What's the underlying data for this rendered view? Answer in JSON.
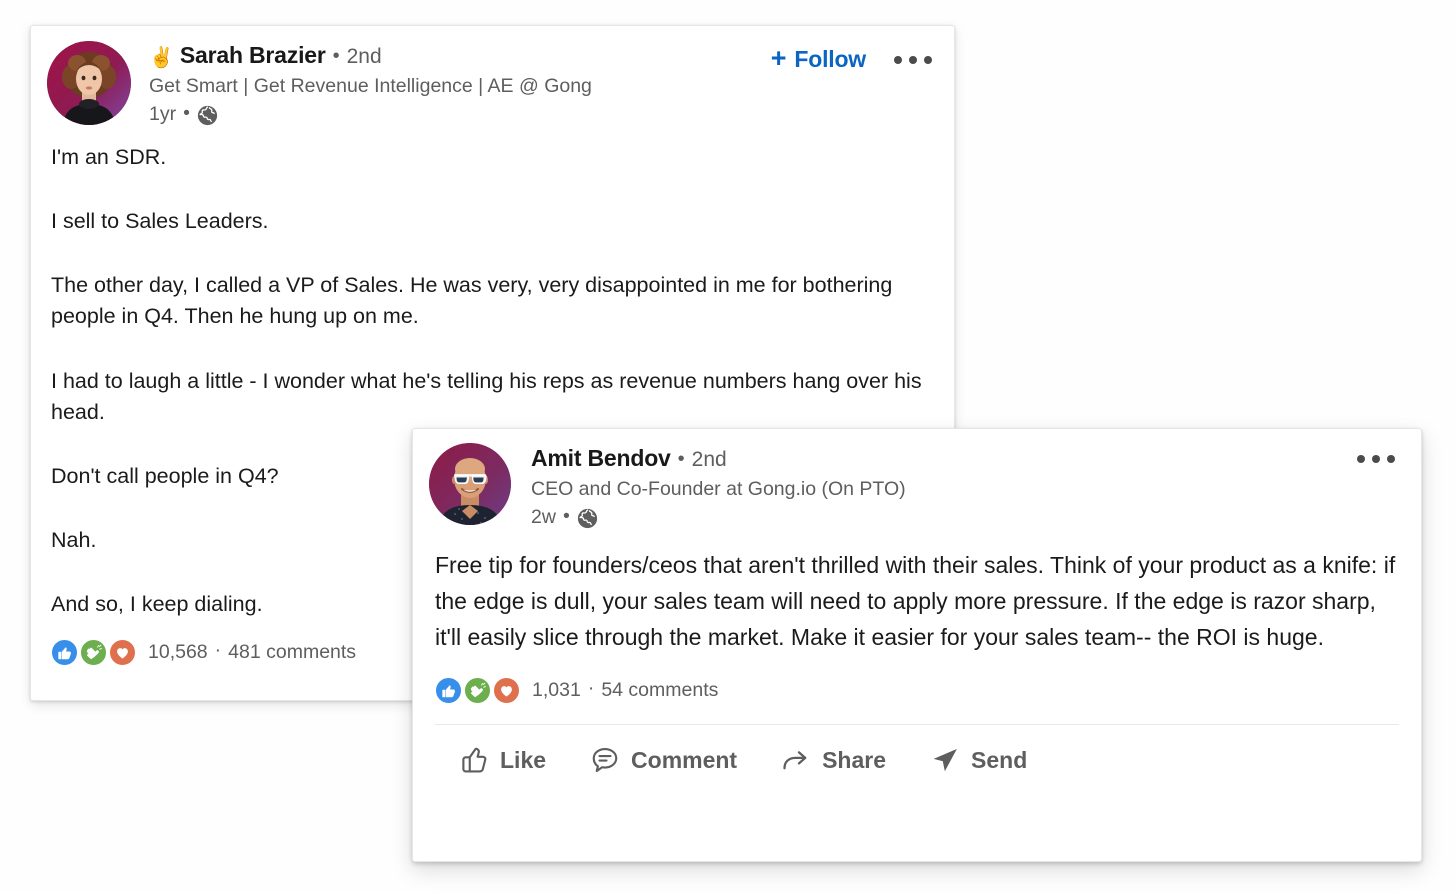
{
  "app": {
    "platform": "LinkedIn",
    "background_color": "#fefefe",
    "accent_color": "#0a66c2",
    "text_primary_color": "#1b1b1b",
    "text_secondary_color": "#5e5e5e"
  },
  "posts": [
    {
      "id": "post-sarah",
      "author": {
        "emoji": "✌️",
        "name": "Sarah Brazier",
        "degree_separator": "•",
        "degree": "2nd",
        "headline": "Get Smart | Get Revenue Intelligence | AE @ Gong",
        "avatar_alt": "Sarah Brazier profile photo"
      },
      "meta": {
        "timestamp": "1yr",
        "separator": "•",
        "visibility_icon": "globe-icon"
      },
      "header_actions": {
        "follow_plus": "+",
        "follow_label": "Follow",
        "more_label": "More options"
      },
      "body_paragraphs": [
        "I'm an SDR.",
        "I sell to Sales Leaders.",
        "The other day, I called a VP of Sales. He was very, very disappointed in me for bothering people in Q4. Then he hung up on me.",
        "I had to laugh a little - I wonder what he's telling his reps as revenue numbers hang over his head.",
        "Don't call people in Q4?",
        "Nah.",
        "And so, I keep dialing."
      ],
      "social": {
        "reactions": [
          "like",
          "celebrate",
          "love"
        ],
        "reaction_count": "10,568",
        "separator": "·",
        "comments": "481 comments"
      }
    },
    {
      "id": "post-amit",
      "author": {
        "emoji": "",
        "name": "Amit Bendov",
        "degree_separator": "•",
        "degree": "2nd",
        "headline": "CEO and Co-Founder at Gong.io (On PTO)",
        "avatar_alt": "Amit Bendov profile photo"
      },
      "meta": {
        "timestamp": "2w",
        "separator": "•",
        "visibility_icon": "globe-icon"
      },
      "header_actions": {
        "more_label": "More options"
      },
      "body_paragraphs": [
        "Free tip for founders/ceos that aren't thrilled with their sales. Think of your product as a knife: if the edge is dull, your sales team will need to apply more pressure. If the edge is razor sharp, it'll easily slice through the market. Make it easier for your sales team-- the ROI is huge."
      ],
      "social": {
        "reactions": [
          "like",
          "celebrate",
          "love"
        ],
        "reaction_count": "1,031",
        "separator": "·",
        "comments": "54 comments"
      },
      "actions": [
        {
          "icon": "thumbs-up-icon",
          "label": "Like"
        },
        {
          "icon": "comment-bubble-icon",
          "label": "Comment"
        },
        {
          "icon": "share-arrow-icon",
          "label": "Share"
        },
        {
          "icon": "send-plane-icon",
          "label": "Send"
        }
      ]
    }
  ]
}
